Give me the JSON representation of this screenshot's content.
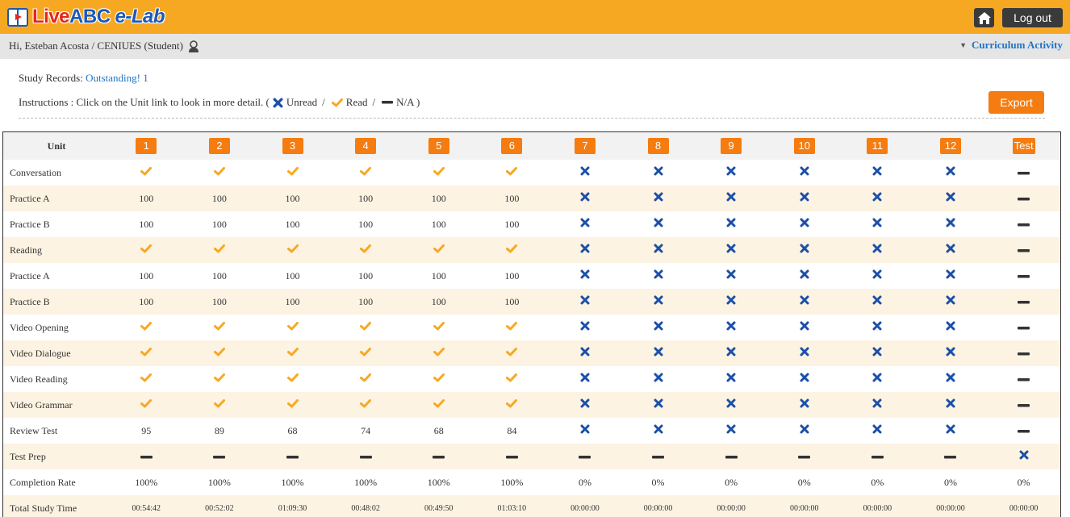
{
  "header": {
    "logo_live": "Live",
    "logo_abc": "ABC",
    "logo_elab": "e-Lab",
    "home_icon": "home-icon",
    "logout_label": "Log out"
  },
  "greeting": {
    "text": "Hi, Esteban Acosta / CENIUES (Student)",
    "user_icon": "user-icon",
    "curriculum_label": "Curriculum Activity"
  },
  "records": {
    "label": "Study Records:",
    "outstanding": "Outstanding! 1"
  },
  "instructions": {
    "prefix": "Instructions : Click on the Unit link to look in more detail. (",
    "unread": "Unread",
    "sep1": "/",
    "read": "Read",
    "sep2": "/",
    "na": "N/A )"
  },
  "export_label": "Export",
  "colors": {
    "accent": "#f7a823",
    "badge": "#f57c10",
    "unread": "#1b4fa8",
    "read": "#f7a823",
    "link": "#1f74c5"
  },
  "table": {
    "unit_header": "Unit",
    "columns": [
      "1",
      "2",
      "3",
      "4",
      "5",
      "6",
      "7",
      "8",
      "9",
      "10",
      "11",
      "12",
      "Test"
    ],
    "rows": [
      {
        "label": "Conversation",
        "cells": [
          "read",
          "read",
          "read",
          "read",
          "read",
          "read",
          "unread",
          "unread",
          "unread",
          "unread",
          "unread",
          "unread",
          "na"
        ]
      },
      {
        "label": "Practice A",
        "cells": [
          "100",
          "100",
          "100",
          "100",
          "100",
          "100",
          "unread",
          "unread",
          "unread",
          "unread",
          "unread",
          "unread",
          "na"
        ]
      },
      {
        "label": "Practice B",
        "cells": [
          "100",
          "100",
          "100",
          "100",
          "100",
          "100",
          "unread",
          "unread",
          "unread",
          "unread",
          "unread",
          "unread",
          "na"
        ]
      },
      {
        "label": "Reading",
        "cells": [
          "read",
          "read",
          "read",
          "read",
          "read",
          "read",
          "unread",
          "unread",
          "unread",
          "unread",
          "unread",
          "unread",
          "na"
        ]
      },
      {
        "label": "Practice A",
        "cells": [
          "100",
          "100",
          "100",
          "100",
          "100",
          "100",
          "unread",
          "unread",
          "unread",
          "unread",
          "unread",
          "unread",
          "na"
        ]
      },
      {
        "label": "Practice B",
        "cells": [
          "100",
          "100",
          "100",
          "100",
          "100",
          "100",
          "unread",
          "unread",
          "unread",
          "unread",
          "unread",
          "unread",
          "na"
        ]
      },
      {
        "label": "Video Opening",
        "cells": [
          "read",
          "read",
          "read",
          "read",
          "read",
          "read",
          "unread",
          "unread",
          "unread",
          "unread",
          "unread",
          "unread",
          "na"
        ]
      },
      {
        "label": "Video Dialogue",
        "cells": [
          "read",
          "read",
          "read",
          "read",
          "read",
          "read",
          "unread",
          "unread",
          "unread",
          "unread",
          "unread",
          "unread",
          "na"
        ]
      },
      {
        "label": "Video Reading",
        "cells": [
          "read",
          "read",
          "read",
          "read",
          "read",
          "read",
          "unread",
          "unread",
          "unread",
          "unread",
          "unread",
          "unread",
          "na"
        ]
      },
      {
        "label": "Video Grammar",
        "cells": [
          "read",
          "read",
          "read",
          "read",
          "read",
          "read",
          "unread",
          "unread",
          "unread",
          "unread",
          "unread",
          "unread",
          "na"
        ]
      },
      {
        "label": "Review Test",
        "cells": [
          "95",
          "89",
          "68",
          "74",
          "68",
          "84",
          "unread",
          "unread",
          "unread",
          "unread",
          "unread",
          "unread",
          "na"
        ]
      },
      {
        "label": "Test Prep",
        "cells": [
          "na",
          "na",
          "na",
          "na",
          "na",
          "na",
          "na",
          "na",
          "na",
          "na",
          "na",
          "na",
          "unread"
        ]
      },
      {
        "label": "Completion Rate",
        "cells": [
          "100%",
          "100%",
          "100%",
          "100%",
          "100%",
          "100%",
          "0%",
          "0%",
          "0%",
          "0%",
          "0%",
          "0%",
          "0%"
        ]
      },
      {
        "label": "Total Study Time",
        "small": true,
        "cells": [
          "00:54:42",
          "00:52:02",
          "01:09:30",
          "00:48:02",
          "00:49:50",
          "01:03:10",
          "00:00:00",
          "00:00:00",
          "00:00:00",
          "00:00:00",
          "00:00:00",
          "00:00:00",
          "00:00:00"
        ]
      }
    ]
  }
}
